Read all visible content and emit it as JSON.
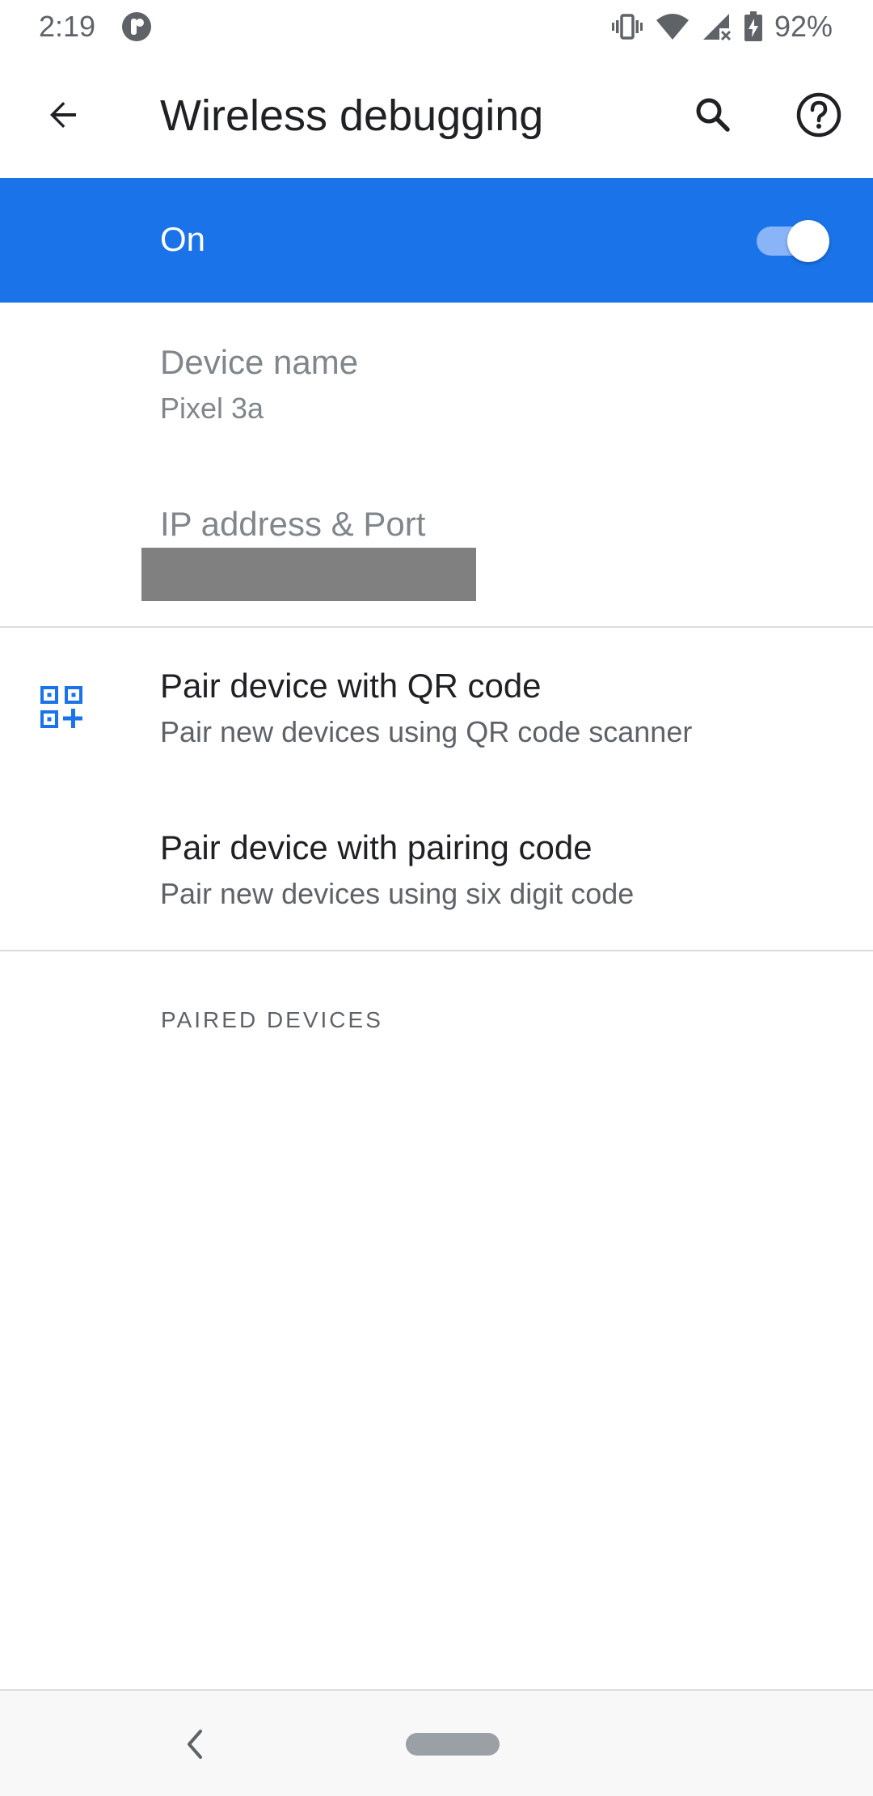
{
  "status_bar": {
    "time": "2:19",
    "battery": "92%",
    "icons": [
      "notification-app-icon",
      "vibrate-icon",
      "wifi-icon",
      "signal-icon",
      "battery-charging-icon"
    ]
  },
  "toolbar": {
    "title": "Wireless debugging",
    "back_icon": "arrow-back-icon",
    "search_icon": "search-icon",
    "help_icon": "help-icon"
  },
  "master_switch": {
    "label": "On",
    "checked": true,
    "accent": "#1a73e8"
  },
  "preferences": {
    "device_name": {
      "title": "Device name",
      "summary": "Pixel 3a"
    },
    "ip_address": {
      "title": "IP address & Port"
    },
    "pair_qr": {
      "title": "Pair device with QR code",
      "summary": "Pair new devices using QR code scanner",
      "icon": "qr-code-scanner-icon"
    },
    "pair_code": {
      "title": "Pair device with pairing code",
      "summary": "Pair new devices using six digit code"
    }
  },
  "paired_devices": {
    "header": "PAIRED DEVICES"
  },
  "nav_bar": {
    "back_icon": "nav-back-icon",
    "home_icon": "nav-home-pill"
  }
}
